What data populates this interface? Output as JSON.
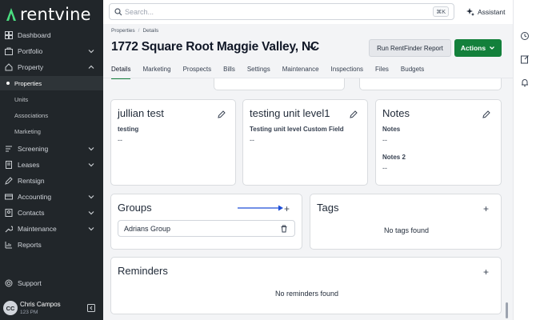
{
  "app": {
    "logo_text": "rentvine",
    "brand_color": "#13803b",
    "sidebar_bg": "#21262a"
  },
  "sidebar": {
    "items": [
      {
        "label": "Dashboard",
        "icon": "dashboard-icon"
      },
      {
        "label": "Portfolio",
        "icon": "portfolio-icon",
        "has_chevron": true
      },
      {
        "label": "Property",
        "icon": "home-icon",
        "expanded": true
      },
      {
        "label": "Screening",
        "icon": "screening-icon",
        "has_chevron": true
      },
      {
        "label": "Leases",
        "icon": "leases-icon",
        "has_chevron": true
      },
      {
        "label": "Rentsign",
        "icon": "pen-icon"
      },
      {
        "label": "Accounting",
        "icon": "accounting-icon",
        "has_chevron": true
      },
      {
        "label": "Contacts",
        "icon": "contacts-icon",
        "has_chevron": true
      },
      {
        "label": "Maintenance",
        "icon": "wrench-icon",
        "has_chevron": true
      },
      {
        "label": "Reports",
        "icon": "reports-icon"
      }
    ],
    "property_sub": [
      "Properties",
      "Units",
      "Associations",
      "Marketing"
    ],
    "support_label": "Support",
    "user": {
      "initials": "CC",
      "name": "Chris Campos",
      "sub": "123 PM"
    }
  },
  "topbar": {
    "search_placeholder": "Search...",
    "search_shortcut": "⌘K",
    "assistant_label": "Assistant"
  },
  "header": {
    "breadcrumbs": [
      "Properties",
      "Details"
    ],
    "title": "1772 Square Root Maggie Valley, NC",
    "report_button": "Run RentFinder Report",
    "actions_button": "Actions",
    "tabs": [
      "Details",
      "Marketing",
      "Prospects",
      "Bills",
      "Settings",
      "Maintenance",
      "Inspections",
      "Files",
      "Budgets"
    ],
    "active_tab": "Details"
  },
  "cards": {
    "julian": {
      "title": "jullian test",
      "field_label": "testing",
      "field_value": "--"
    },
    "unit_level": {
      "title": "testing unit level1",
      "field_label": "Testing unit level Custom Field",
      "field_value": "--"
    },
    "notes": {
      "title": "Notes",
      "field1_label": "Notes",
      "field1_value": "--",
      "field2_label": "Notes 2",
      "field2_value": "--"
    },
    "groups": {
      "title": "Groups",
      "items": [
        "Adrians Group"
      ]
    },
    "tags": {
      "title": "Tags",
      "empty": "No tags found"
    },
    "reminders": {
      "title": "Reminders",
      "empty": "No reminders found"
    }
  }
}
